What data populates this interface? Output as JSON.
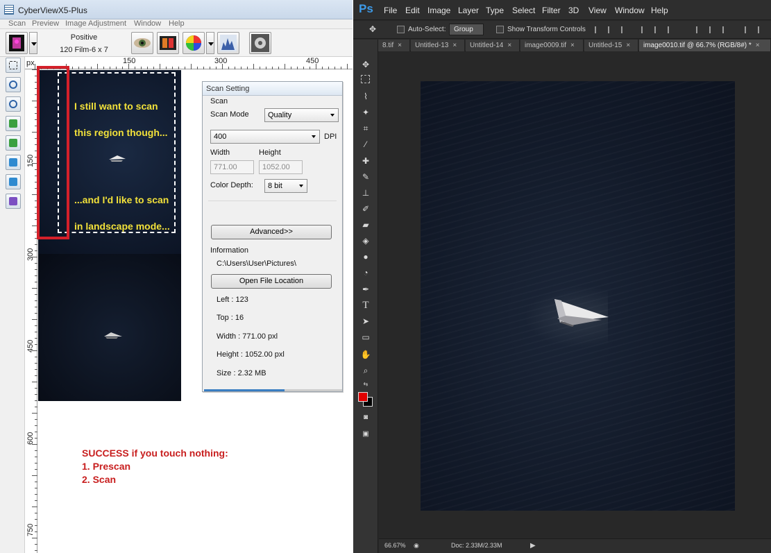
{
  "cyberview": {
    "title": "CyberViewX5-Plus",
    "menu": [
      "Scan",
      "Preview",
      "Image Adjustment",
      "Window",
      "Help"
    ],
    "toolbar": {
      "film_mode": "Positive",
      "film_type": "120 Film-6 x 7"
    },
    "ruler": {
      "unit": "px",
      "top_ticks": [
        "150",
        "300",
        "450"
      ],
      "left_ticks": [
        "150",
        "300",
        "450",
        "600",
        "750"
      ]
    },
    "annotations": {
      "region_note_line1": "I still want to scan",
      "region_note_line2": "this region though...",
      "landscape_note_line1": "...and I'd like to scan",
      "landscape_note_line2": "in landscape mode...",
      "success_title": "SUCCESS if you touch nothing:",
      "success_step1": "1. Prescan",
      "success_step2": "2. Scan"
    },
    "scan_setting": {
      "title": "Scan Setting",
      "section_scan": "Scan",
      "scan_mode_label": "Scan Mode",
      "scan_mode_value": "Quality",
      "dpi_value": "400",
      "dpi_label": "DPI",
      "width_label": "Width",
      "height_label": "Height",
      "width_value": "771.00",
      "height_value": "1052.00",
      "color_depth_label": "Color Depth:",
      "color_depth_value": "8 bit",
      "advanced_button": "Advanced>>",
      "section_info": "Information",
      "path": "C:\\Users\\User\\Pictures\\",
      "open_location_button": "Open File Location",
      "left": "Left : 123",
      "top": "Top : 16",
      "width_info": "Width : 771.00 pxl",
      "height_info": "Height : 1052.00 pxl",
      "size_info": "Size : 2.32 MB"
    }
  },
  "photoshop": {
    "logo": "Ps",
    "menu": [
      "File",
      "Edit",
      "Image",
      "Layer",
      "Type",
      "Select",
      "Filter",
      "3D",
      "View",
      "Window",
      "Help"
    ],
    "options": {
      "auto_select": "Auto-Select:",
      "group": "Group",
      "show_transform": "Show Transform Controls"
    },
    "tabs": [
      {
        "label": "8.tif"
      },
      {
        "label": "Untitled-13"
      },
      {
        "label": "Untitled-14"
      },
      {
        "label": "image0009.tif"
      },
      {
        "label": "Untitled-15"
      },
      {
        "label": "image0010.tif @ 66.7% (RGB/8#) *"
      }
    ],
    "status": {
      "zoom": "66.67%",
      "doc": "Doc: 2.33M/2.33M"
    },
    "colors": {
      "foreground": "#e00000",
      "background": "#000000"
    }
  }
}
